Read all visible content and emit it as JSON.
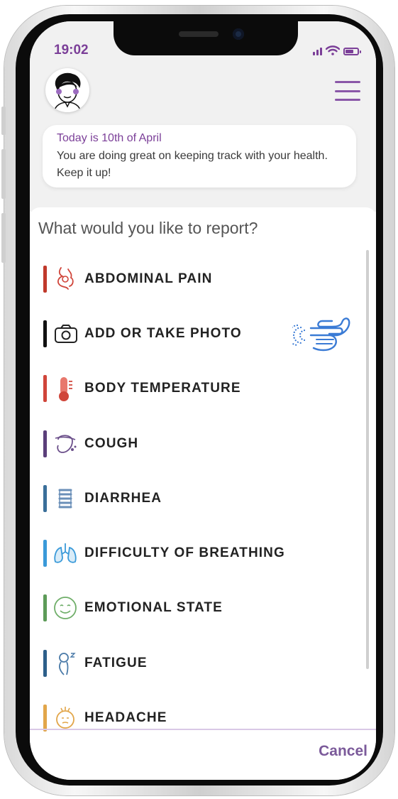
{
  "status_bar": {
    "time": "19:02"
  },
  "header": {
    "avatar": "avatar-icon",
    "menu_icon": "hamburger-menu-icon"
  },
  "today_card": {
    "title": "Today is 10th of April",
    "message": "You are doing great on keeping track with your health. Keep it up!"
  },
  "report": {
    "question": "What would you like to report?",
    "items": [
      {
        "label": "ABDOMINAL PAIN",
        "icon": "abdomen-icon",
        "color": "#c0392b"
      },
      {
        "label": "ADD OR TAKE PHOTO",
        "icon": "camera-icon",
        "color": "#111111"
      },
      {
        "label": "BODY TEMPERATURE",
        "icon": "thermometer-icon",
        "color": "#d0453a"
      },
      {
        "label": "COUGH",
        "icon": "cough-icon",
        "color": "#5b3f7a"
      },
      {
        "label": "DIARRHEA",
        "icon": "intestine-icon",
        "color": "#3a6f9a"
      },
      {
        "label": "DIFFICULTY OF BREATHING",
        "icon": "lungs-icon",
        "color": "#3a9ad9"
      },
      {
        "label": "EMOTIONAL STATE",
        "icon": "smiley-icon",
        "color": "#5d9b58"
      },
      {
        "label": "FATIGUE",
        "icon": "fatigue-icon",
        "color": "#2d5f8a"
      },
      {
        "label": "HEADACHE",
        "icon": "headache-icon",
        "color": "#e2a64a"
      }
    ]
  },
  "footer": {
    "cancel_label": "Cancel"
  },
  "colors": {
    "brand": "#7b3f98",
    "hint_hand": "#3a7bd5"
  }
}
